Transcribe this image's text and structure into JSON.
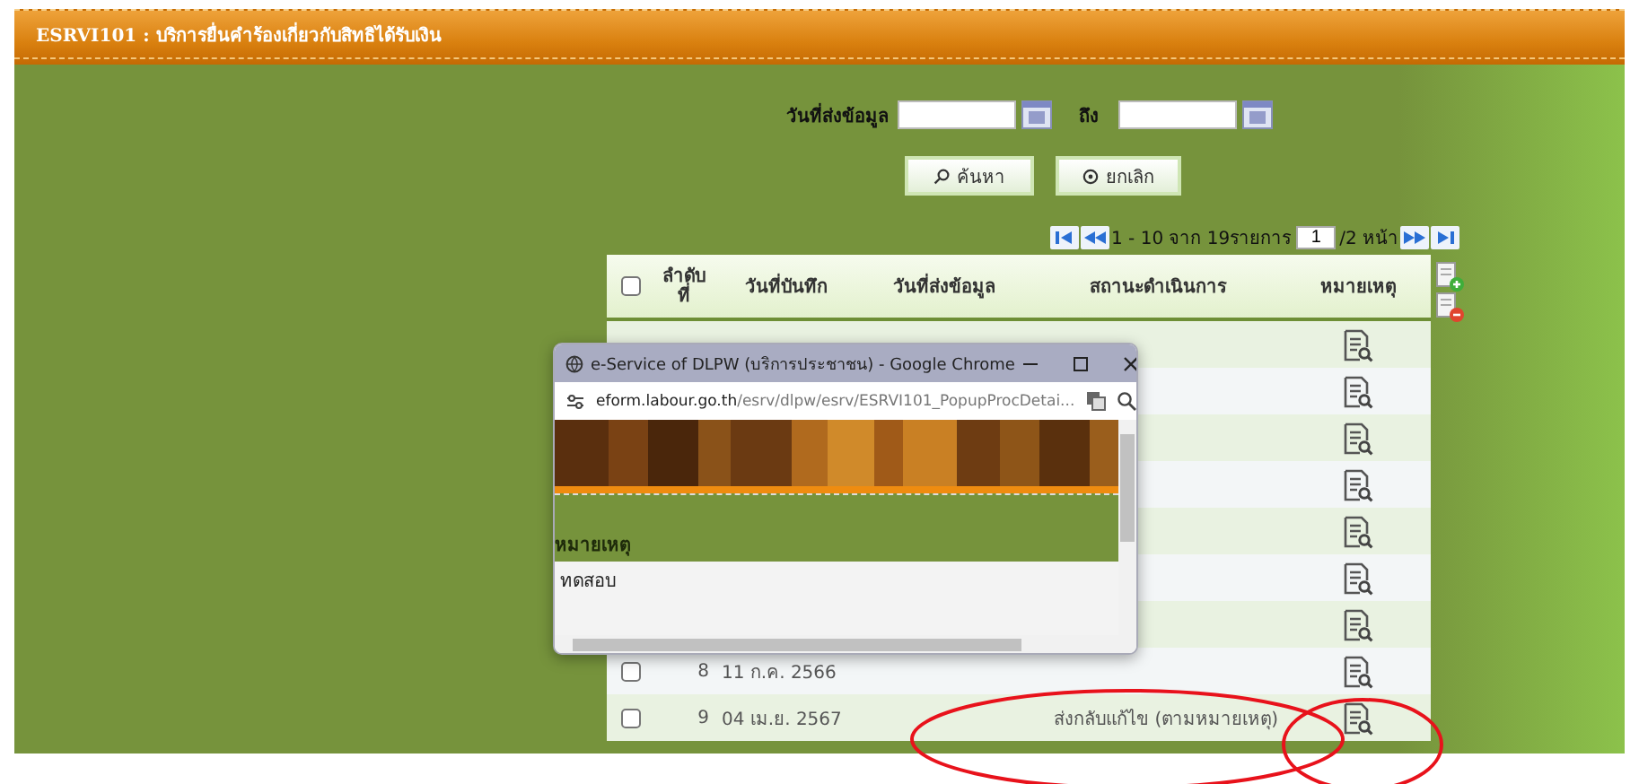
{
  "header": {
    "title": "ESRVI101 : บริการยื่นคำร้องเกี่ยวกับสิทธิได้รับเงิน"
  },
  "search": {
    "label": "วันที่ส่งข้อมูล",
    "to_label": "ถึง"
  },
  "buttons": [
    {
      "label": "ค้นหา",
      "kind": "search"
    },
    {
      "label": "ยกเลิก",
      "kind": "cancel"
    }
  ],
  "pager": {
    "summary": "1 - 10 จาก 19รายการ",
    "page": "1",
    "total": "/2 หน้า"
  },
  "table": {
    "header_checked": false,
    "columns": [
      "ลำดับ ที่",
      "วันที่บันทึก",
      "วันที่ส่งข้อมูล",
      "สถานะดำเนินการ",
      "หมายเหตุ"
    ],
    "rows": [
      {
        "has_remark": true
      },
      {
        "has_remark": true
      },
      {
        "has_remark": true
      },
      {
        "has_remark": true
      },
      {
        "has_remark": true
      },
      {
        "has_remark": true
      },
      {
        "has_remark": true
      },
      {
        "checked": false,
        "order": "8",
        "recorded": "11 ก.ค. 2566",
        "has_remark": true
      },
      {
        "checked": false,
        "order": "9",
        "recorded": "04 เม.ย. 2567",
        "status": "ส่งกลับแก้ไข (ตามหมายเหตุ)",
        "has_remark": true
      }
    ]
  },
  "popup": {
    "title": "e-Service of DLPW (บริการประชาชน) - Google Chrome",
    "url_host": "eform.labour.go.th",
    "url_path": "/esrv/dlpw/esrv/ESRVI101_PopupProcDetai...",
    "field_label": "หมายเหตุ",
    "field_value": "ทดสอบ"
  }
}
